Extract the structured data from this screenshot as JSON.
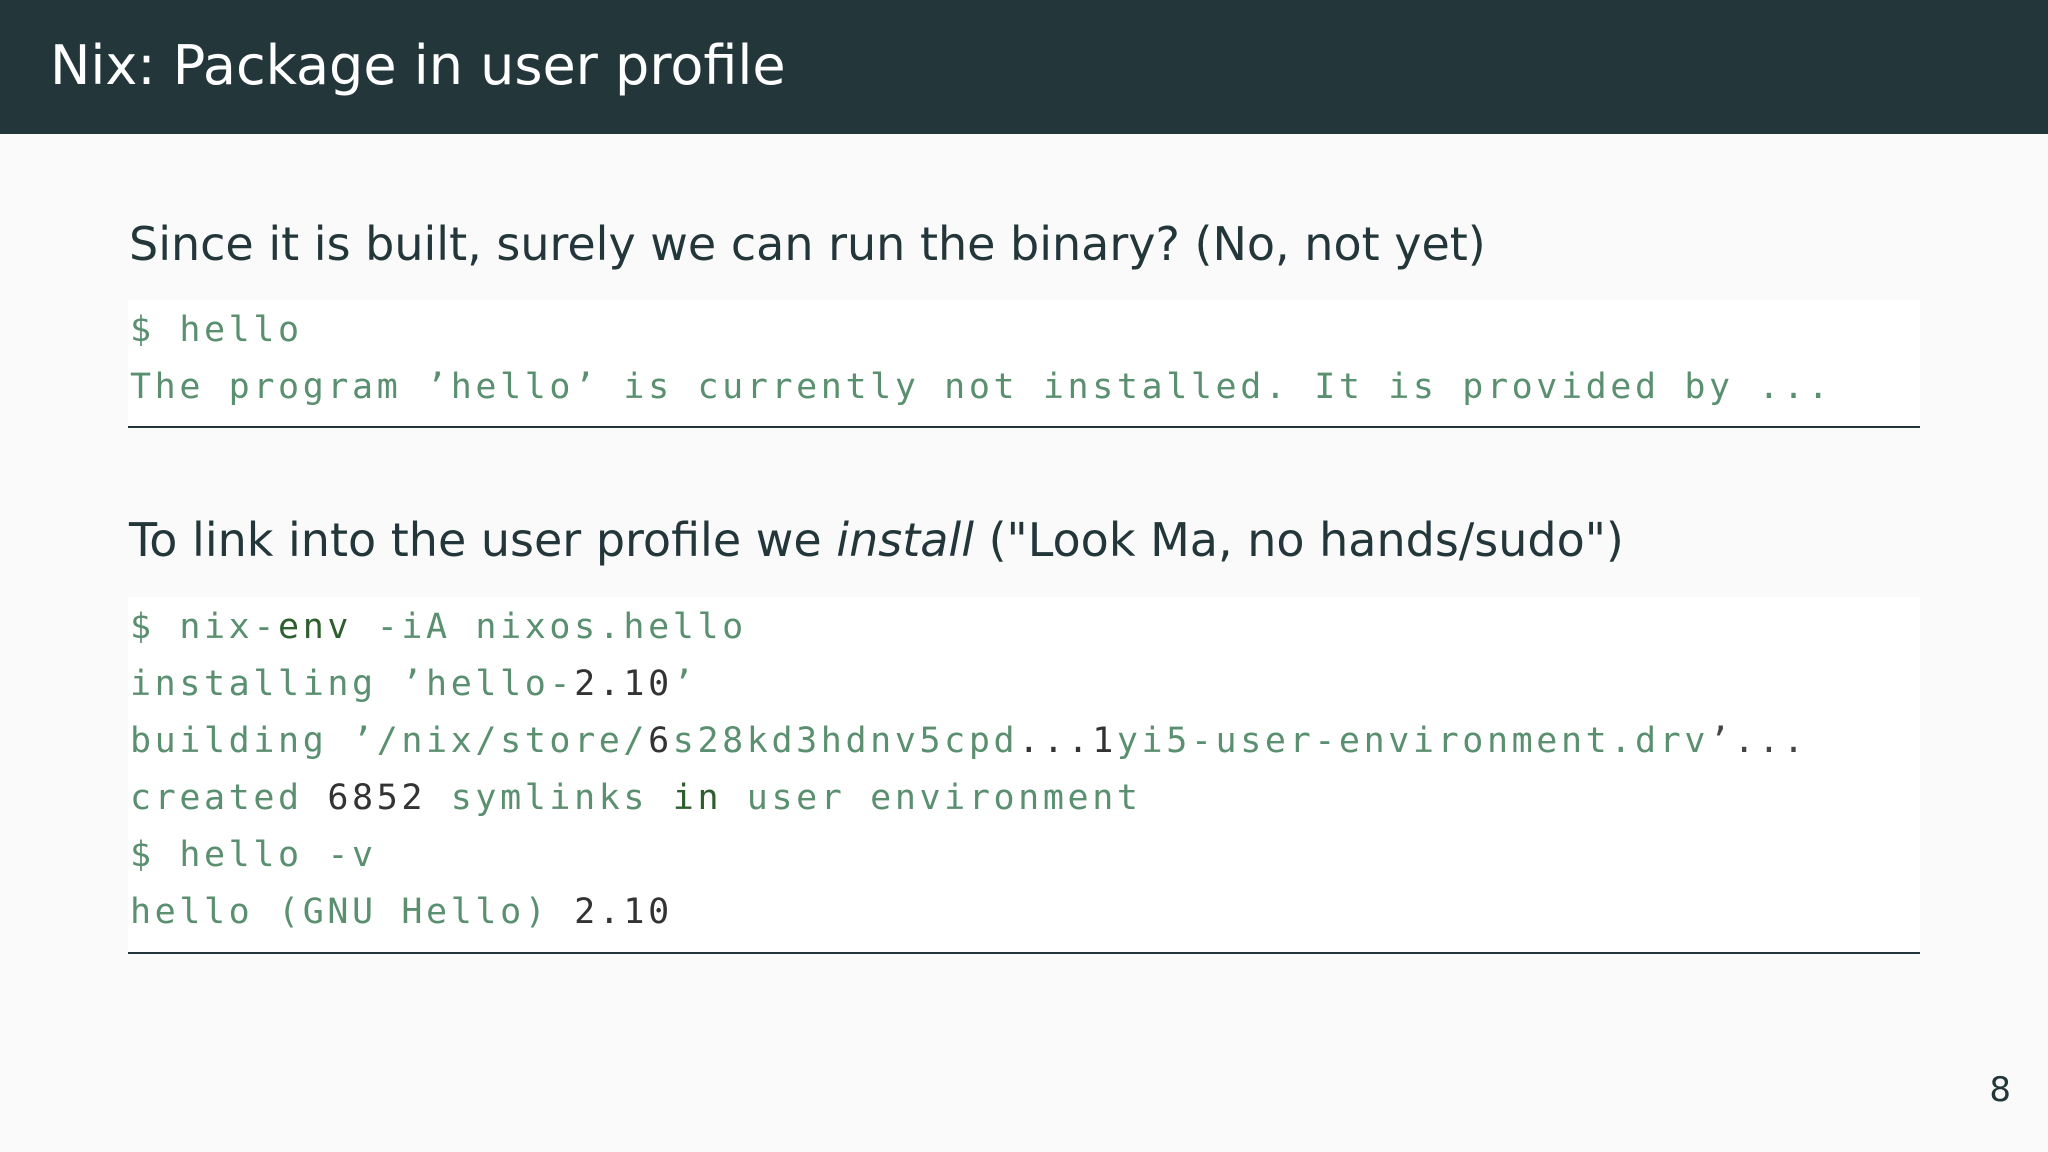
{
  "slide": {
    "title": "Nix: Package in user profile",
    "page_number": "8"
  },
  "section1": {
    "heading": "Since it is built, surely we can run the binary? (No, not yet)",
    "code": {
      "line1": "$ hello",
      "line2": "The program ’hello’ is currently not installed. It is provided by ..."
    }
  },
  "section2": {
    "heading_before": "To link into the user profile we ",
    "heading_em": "install",
    "heading_after": " (\"Look Ma, no hands/sudo\")",
    "code": {
      "line1_a": "$ nix-",
      "line1_b": "env",
      "line1_c": " -iA nixos.hello",
      "line2_a": "installing ’hello-",
      "line2_b": "2.10",
      "line2_c": "’",
      "line3_a": "building ’/nix/store/",
      "line3_b": "6",
      "line3_c": "s28kd3hdnv5cpd",
      "line3_d": "...1",
      "line3_e": "yi5-user-environment.drv",
      "line3_f": "’...",
      "line4_a": "created ",
      "line4_b": "6852",
      "line4_c": " symlinks ",
      "line4_d": "in",
      "line4_e": " user environment",
      "line5": "$ hello -v",
      "line6_a": "hello (GNU Hello) ",
      "line6_b": "2.10"
    }
  }
}
